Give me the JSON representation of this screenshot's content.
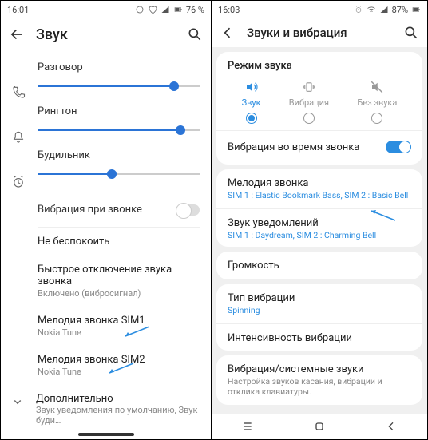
{
  "phone1": {
    "time": "16:01",
    "battery": "76 %",
    "title": "Звук",
    "sliders": {
      "call": {
        "label": "Разговор",
        "fill": 84
      },
      "ring": {
        "label": "Рингтон",
        "fill": 88
      },
      "alarm": {
        "label": "Будильник",
        "fill": 46
      }
    },
    "vibrate": "Вибрация при звонке",
    "items": {
      "dnd": {
        "title": "Не беспокоить",
        "sub": ""
      },
      "mute": {
        "title": "Быстрое отключение звука звонка",
        "sub": "Включено (вибросигнал)"
      },
      "sim1": {
        "title": "Мелодия звонка SIM1",
        "sub": "Nokia Tune"
      },
      "sim2": {
        "title": "Мелодия звонка SIM2",
        "sub": "Nokia Tune"
      },
      "more": {
        "title": "Дополнительно",
        "sub": "Звук уведомления по умолчанию, Звук буди…"
      }
    }
  },
  "phone2": {
    "time": "16:03",
    "battery": "87%",
    "title": "Звуки и вибрация",
    "soundmode": {
      "heading": "Режим звука",
      "sound": "Звук",
      "vibrate": "Вибрация",
      "mute": "Без звука"
    },
    "vibcall": "Вибрация во время звонка",
    "rows": {
      "ringtone": {
        "title": "Мелодия звонка",
        "sub": "SIM 1 : Elastic Bookmark Bass, SIM 2 : Basic Bell"
      },
      "notif": {
        "title": "Звук уведомлений",
        "sub": "SIM 1 : Daydream, SIM 2 : Charming Bell"
      },
      "volume": {
        "title": "Громкость"
      },
      "vibtype": {
        "title": "Тип вибрации",
        "sub": "Spinning"
      },
      "vibint": {
        "title": "Интенсивность вибрации"
      },
      "sys": {
        "title": "Вибрация/системные звуки",
        "sub": "Настройка звуков касания, вибрации и отклика клавиатуры."
      }
    }
  }
}
